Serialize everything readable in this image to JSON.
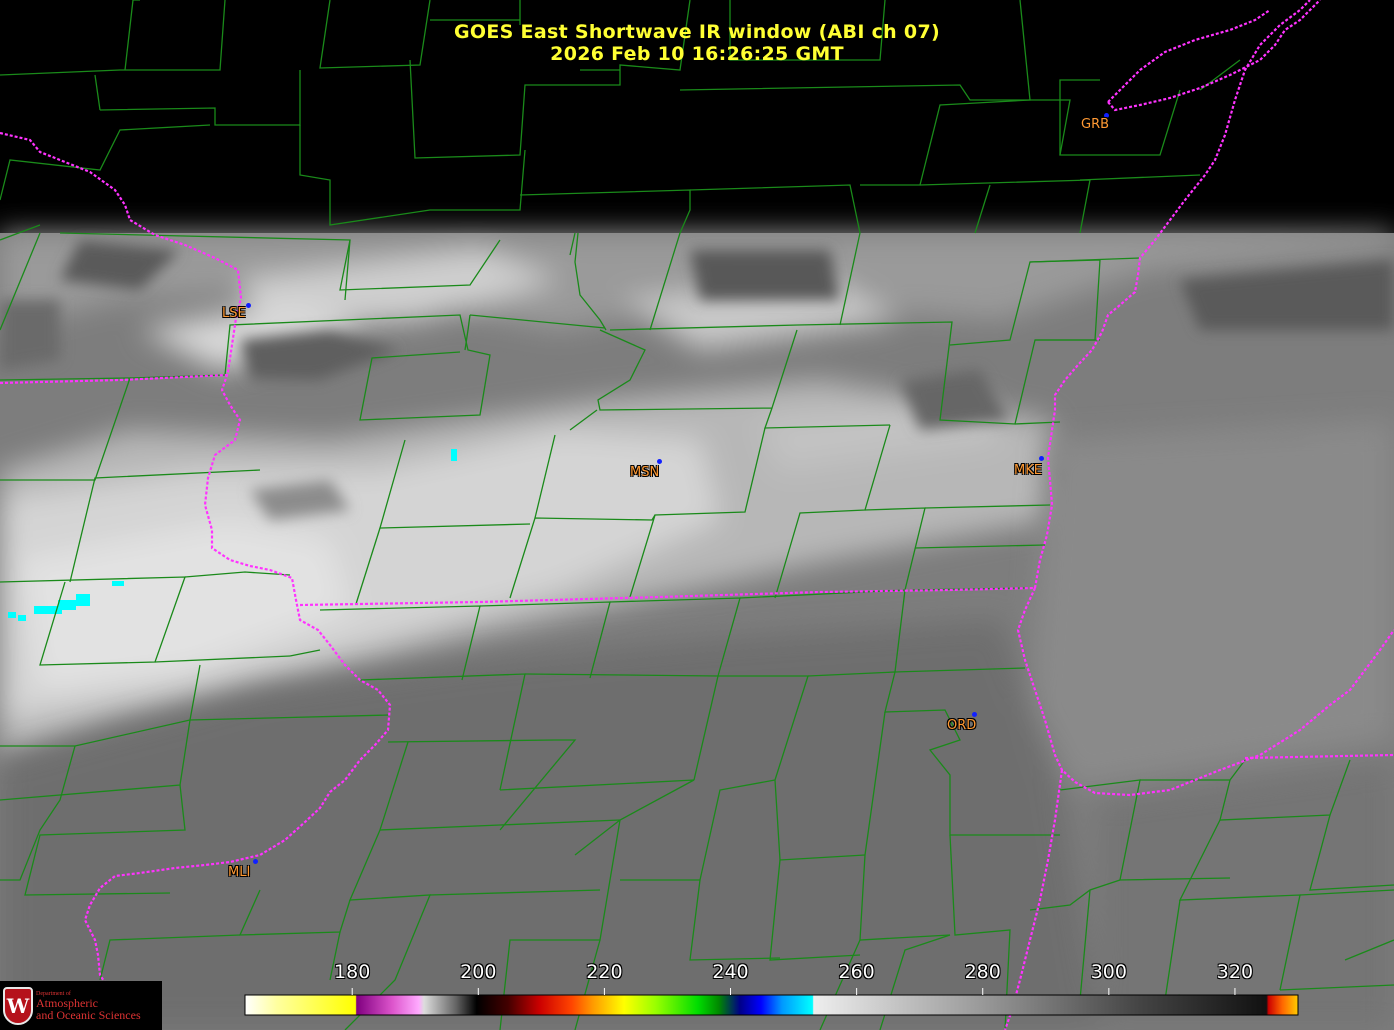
{
  "title": {
    "line1": "GOES East Shortwave IR window (ABI ch 07)",
    "line2": "2026 Feb 10  16:26:25 GMT"
  },
  "stations": [
    {
      "id": "GRB",
      "label": "GRB"
    },
    {
      "id": "LSE",
      "label": "LSE"
    },
    {
      "id": "MSN",
      "label": "MSN"
    },
    {
      "id": "MKE",
      "label": "MKE"
    },
    {
      "id": "ORD",
      "label": "ORD"
    },
    {
      "id": "MLI",
      "label": "MLI"
    }
  ],
  "colorbar": {
    "unit_hint": "Brightness temperature",
    "min": 163,
    "max": 330,
    "ticks": [
      "180",
      "200",
      "220",
      "240",
      "260",
      "280",
      "300",
      "320"
    ],
    "tick_values": [
      180,
      200,
      220,
      240,
      260,
      280,
      300,
      320
    ]
  },
  "logo": {
    "dept": "Department of",
    "name1": "Atmospheric",
    "name2": "and Oceanic Sciences",
    "crest": "W"
  },
  "colors": {
    "title": "#ffff33",
    "county_lines": "#1a8a1a",
    "state_lines": "#ff33ff",
    "station_label": "#ff9933",
    "station_dot": "#1020ff",
    "cold_pixels": "#00ffff"
  }
}
